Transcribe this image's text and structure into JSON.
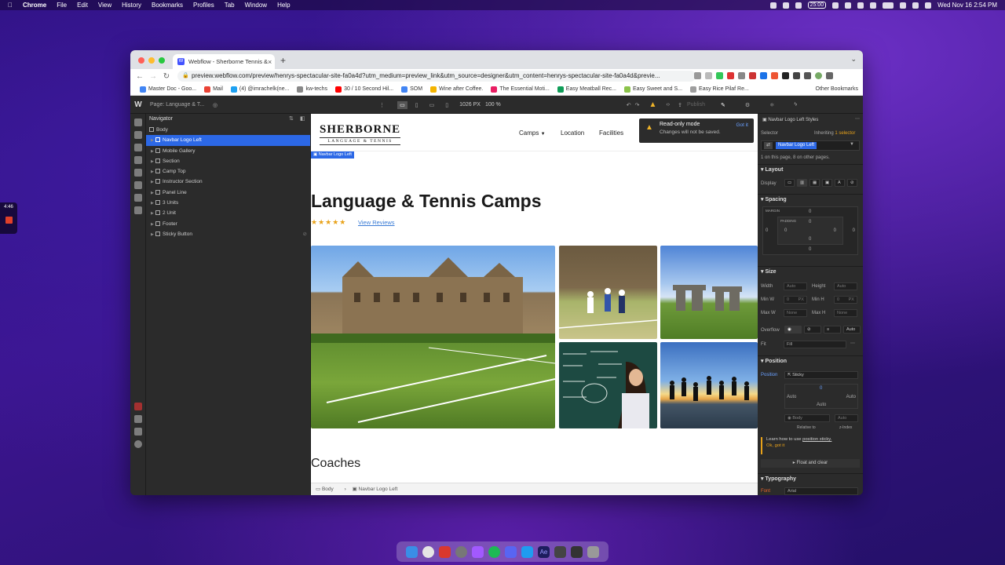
{
  "menubar": {
    "app": "Chrome",
    "items": [
      "File",
      "Edit",
      "View",
      "History",
      "Bookmarks",
      "Profiles",
      "Tab",
      "Window",
      "Help"
    ],
    "timer": "25:00",
    "datetime": "Wed Nov 16  2:54 PM"
  },
  "recorder": {
    "time": "4:46"
  },
  "browser": {
    "tab_title": "Webflow - Sherborne Tennis &",
    "url": "preview.webflow.com/preview/henrys-spectacular-site-fa0a4d?utm_medium=preview_link&utm_source=designer&utm_content=henrys-spectacular-site-fa0a4d&previe...",
    "bookmarks": [
      "Master Doc - Goo...",
      "Mail",
      "(4) @imrachelk(ne...",
      "kw-techs",
      "30 / 10 Second Hil...",
      "SOM",
      "Wine after Coffee.",
      "The Essential Moti...",
      "Easy Meatball Rec...",
      "Easy Sweet and S...",
      "Easy Rice Pilaf Re..."
    ],
    "other_bookmarks": "Other Bookmarks"
  },
  "webflow": {
    "page_label": "Page: Language & T...",
    "viewport_width": "1026 PX",
    "zoom": "100 %",
    "publish": "Publish"
  },
  "navigator": {
    "title": "Navigator",
    "nodes": [
      {
        "label": "Body",
        "selected": false
      },
      {
        "label": "Navbar Logo Left",
        "selected": true
      },
      {
        "label": "Mobile Gallery",
        "selected": false
      },
      {
        "label": "Section",
        "selected": false
      },
      {
        "label": "Camp Top",
        "selected": false
      },
      {
        "label": "Instructor Section",
        "selected": false
      },
      {
        "label": "Panel Line",
        "selected": false
      },
      {
        "label": "3 Units",
        "selected": false
      },
      {
        "label": "2 Unit",
        "selected": false
      },
      {
        "label": "Footer",
        "selected": false
      },
      {
        "label": "Sticky Button",
        "selected": false
      }
    ]
  },
  "site": {
    "brand": "SHERBORNE",
    "brand_sub": "LANGUAGE & TENNIS",
    "nav": [
      "Camps",
      "Location",
      "Facilities"
    ],
    "selected_chip": "Navbar Logo Left",
    "heading": "Language & Tennis Camps",
    "stars": "★★★★★",
    "reviews_link": "View Reviews",
    "coaches": "Coaches"
  },
  "readonly_toast": {
    "title": "Read-only mode",
    "subtitle": "Changes will not be saved.",
    "action": "Got it"
  },
  "breadcrumb": [
    "Body",
    "Navbar Logo Left"
  ],
  "style_panel": {
    "header": "Navbar Logo Left Styles",
    "selector_label": "Selector",
    "inheriting": "Inheriting",
    "inheriting_count": "1 selector",
    "selector_chip": "Navbar Logo Left",
    "usage": "1 on this page, 8 on other pages.",
    "layout": "Layout",
    "display": "Display",
    "spacing": "Spacing",
    "margin": "MARGIN",
    "padding": "PADDING",
    "zero": "0",
    "size": "Size",
    "width": "Width",
    "height": "Height",
    "min_w": "Min W",
    "min_h": "Min H",
    "max_w": "Max W",
    "max_h": "Max H",
    "auto": "Auto",
    "none": "None",
    "px": "PX",
    "overflow": "Overflow",
    "fit": "Fit",
    "fill": "Fill",
    "position": "Position",
    "position_value": "Sticky",
    "relative_body": "Body",
    "relative_to": "Relative to",
    "z_index": "z-Index",
    "learn": "Learn how to use",
    "learn_link": "position sticky.",
    "ok": "Ok, got it",
    "float": "Float and clear",
    "typography": "Typography",
    "font": "Font",
    "font_value": "Arial"
  },
  "colors": {
    "selection": "#2c68e6",
    "star": "#e8a21a",
    "link": "#3a7bd5",
    "warning": "#f0b429"
  }
}
